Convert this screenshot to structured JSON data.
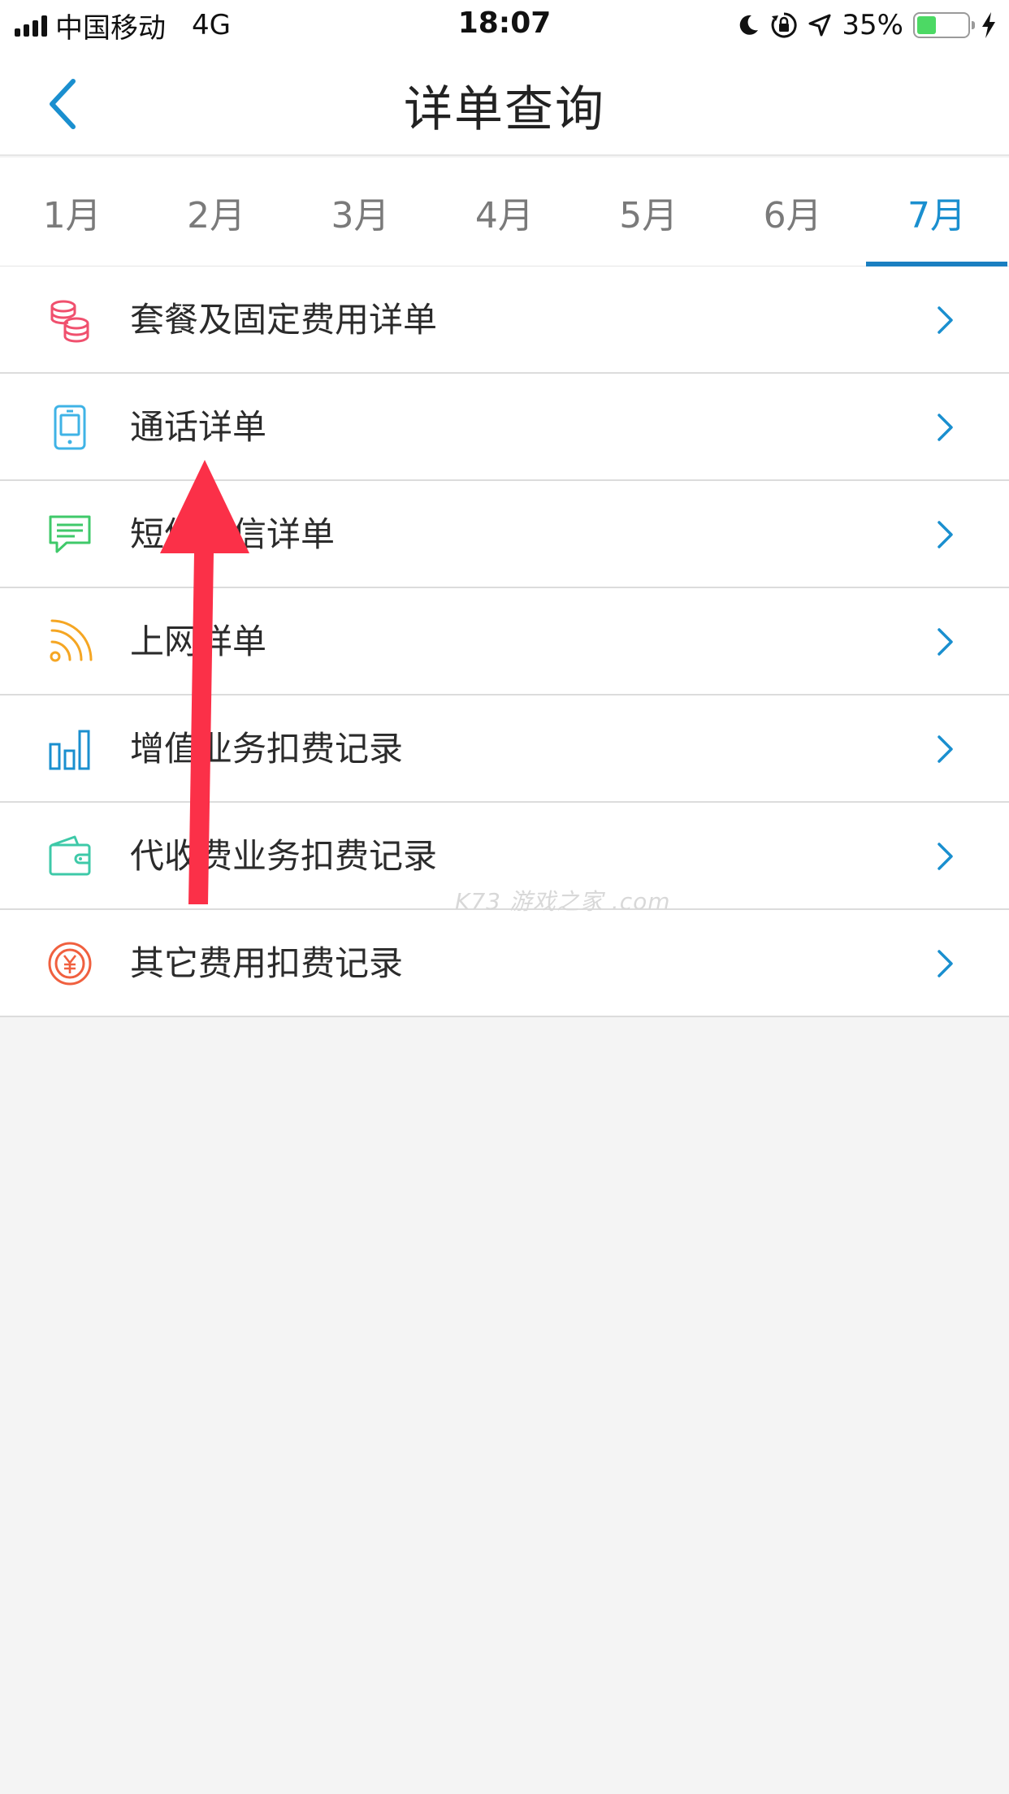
{
  "status_bar": {
    "carrier": "中国移动",
    "network": "4G",
    "time": "18:07",
    "battery_percent_text": "35%",
    "battery_level": 0.35,
    "icons": [
      "signal-icon",
      "moon-icon",
      "rotation-lock-icon",
      "location-icon",
      "battery-icon",
      "charging-icon"
    ]
  },
  "nav": {
    "title": "详单查询",
    "back_icon": "chevron-left-icon"
  },
  "tabs": [
    {
      "label": "1月",
      "active": false
    },
    {
      "label": "2月",
      "active": false
    },
    {
      "label": "3月",
      "active": false
    },
    {
      "label": "4月",
      "active": false
    },
    {
      "label": "5月",
      "active": false
    },
    {
      "label": "6月",
      "active": false
    },
    {
      "label": "7月",
      "active": true
    }
  ],
  "list": [
    {
      "label": "套餐及固定费用详单",
      "icon": "coins-icon",
      "color": "#f0506e"
    },
    {
      "label": "通话详单",
      "icon": "phone-device-icon",
      "color": "#3fb3e6"
    },
    {
      "label": "短信彩信详单",
      "icon": "message-icon",
      "color": "#3fc96a"
    },
    {
      "label": "上网详单",
      "icon": "wifi-feed-icon",
      "color": "#f5a623"
    },
    {
      "label": "增值业务扣费记录",
      "icon": "bar-chart-icon",
      "color": "#1a8fcf"
    },
    {
      "label": "代收费业务扣费记录",
      "icon": "wallet-icon",
      "color": "#3ec9a8"
    },
    {
      "label": "其它费用扣费记录",
      "icon": "yuan-coin-icon",
      "color": "#f0603f"
    }
  ],
  "watermark": "K73 游戏之家 .com",
  "colors": {
    "accent": "#1a8fcf",
    "annotation_arrow": "#fb3048",
    "background": "#f4f4f4"
  }
}
